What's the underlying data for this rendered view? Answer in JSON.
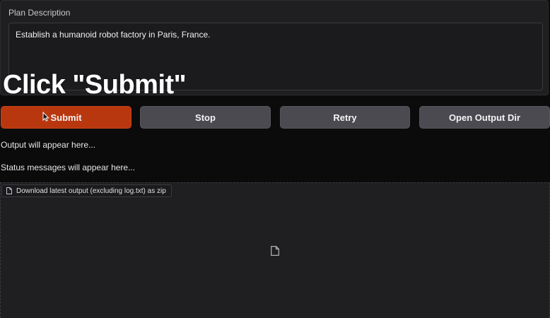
{
  "plan": {
    "label": "Plan Description",
    "value": "Establish a humanoid robot factory in Paris, France."
  },
  "overlay": {
    "caption": "Click \"Submit\""
  },
  "buttons": {
    "submit": "Submit",
    "stop": "Stop",
    "retry": "Retry",
    "open_output_dir": "Open Output Dir"
  },
  "output": {
    "placeholder": "Output will appear here...",
    "status": "Status messages will appear here..."
  },
  "download": {
    "label": "Download latest output (excluding log.txt) as zip",
    "icon": "file-icon"
  },
  "colors": {
    "submit_bg": "#b8370f",
    "button_bg": "#4a4a50",
    "panel_bg": "#1f1f22",
    "page_bg": "#0b0b0c"
  }
}
